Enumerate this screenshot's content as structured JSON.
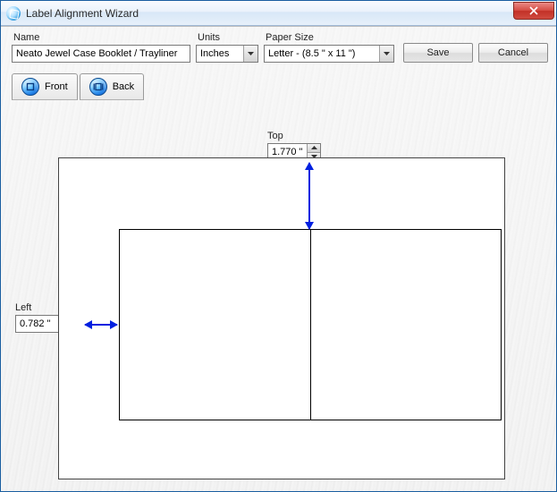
{
  "window": {
    "title": "Label Alignment Wizard"
  },
  "fields": {
    "name_label": "Name",
    "name_value": "Neato Jewel Case Booklet / Trayliner",
    "units_label": "Units",
    "units_value": "Inches",
    "paper_label": "Paper Size",
    "paper_value": "Letter - (8.5 \" x 11 \")"
  },
  "buttons": {
    "save": "Save",
    "cancel": "Cancel"
  },
  "tabs": {
    "front": "Front",
    "back": "Back"
  },
  "margins": {
    "top_label": "Top",
    "top_value": "1.770 \"",
    "left_label": "Left",
    "left_value": "0.782 \""
  }
}
